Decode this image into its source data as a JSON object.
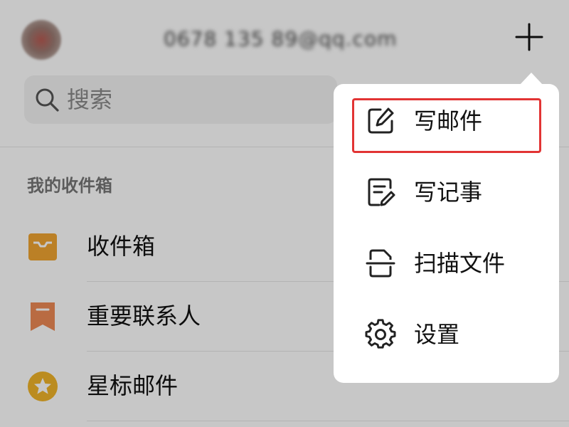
{
  "header": {
    "account_email": "0678 135 89@qq.com",
    "add_button_icon": "plus-icon"
  },
  "search": {
    "placeholder": "搜索",
    "icon": "search-icon"
  },
  "inbox_section": {
    "title": "我的收件箱",
    "items": [
      {
        "label": "收件箱",
        "icon": "inbox-tray-icon",
        "color": "#f0a531"
      },
      {
        "label": "重要联系人",
        "icon": "bookmark-icon",
        "color": "#ee8a55"
      },
      {
        "label": "星标邮件",
        "icon": "star-icon",
        "color": "#f0b429"
      }
    ]
  },
  "popup_menu": {
    "items": [
      {
        "label": "写邮件",
        "icon": "compose-icon",
        "highlighted": true
      },
      {
        "label": "写记事",
        "icon": "note-icon",
        "highlighted": false
      },
      {
        "label": "扫描文件",
        "icon": "scan-icon",
        "highlighted": false
      },
      {
        "label": "设置",
        "icon": "gear-icon",
        "highlighted": false
      }
    ]
  },
  "colors": {
    "highlight": "#e23434",
    "overlay": "rgba(0,0,0,0.22)"
  }
}
